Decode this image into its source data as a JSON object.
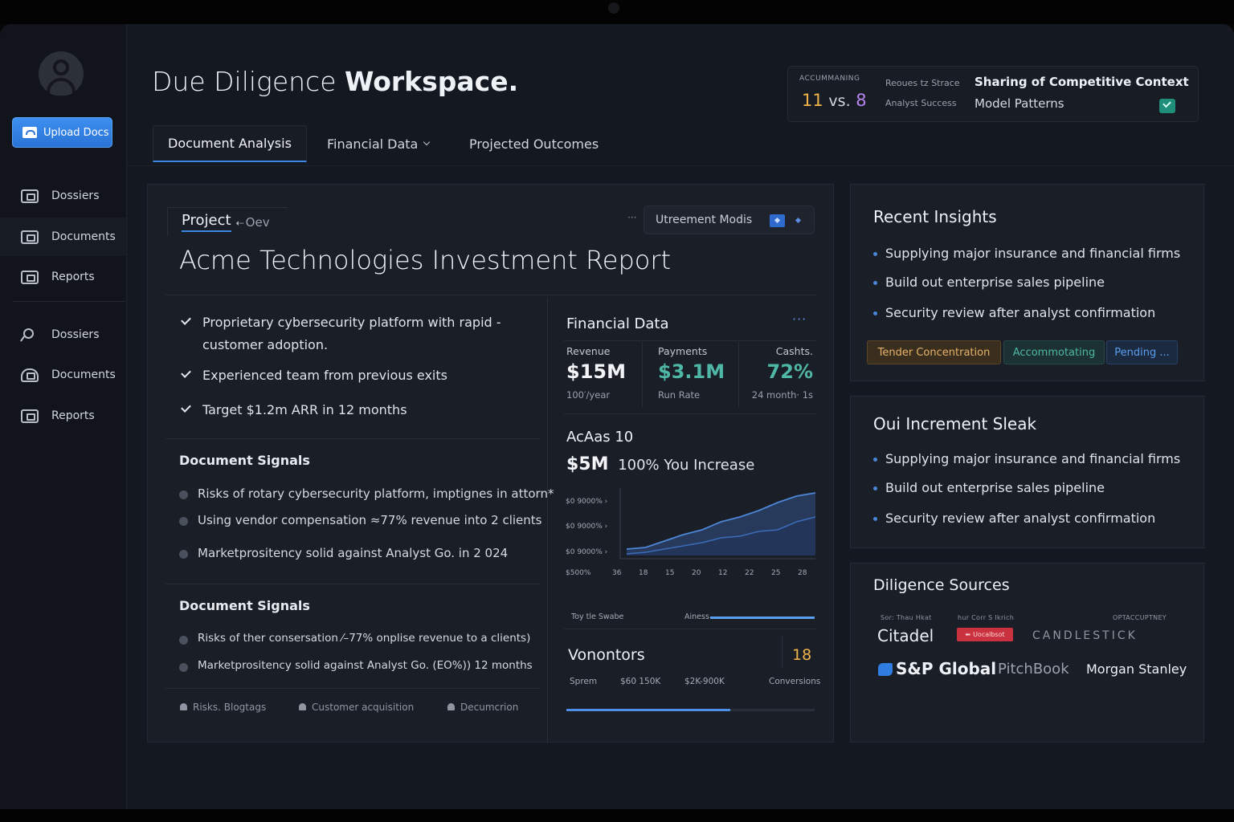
{
  "app": {
    "title_light": "Due Diligence",
    "title_bold": "Workspace."
  },
  "sidebar": {
    "upload_label": "Upload Docs",
    "items": [
      {
        "label": "Dossiers",
        "icon": "folder-icon"
      },
      {
        "label": "Documents",
        "icon": "document-icon"
      },
      {
        "label": "Reports",
        "icon": "report-icon"
      },
      {
        "label": "Dossiers",
        "icon": "link-icon"
      },
      {
        "label": "Documents",
        "icon": "cloud-icon"
      },
      {
        "label": "Reports",
        "icon": "report-icon"
      }
    ]
  },
  "stats": {
    "label_a": "ACCUMMANING",
    "value_1": "11",
    "value_vs": "vs.",
    "value_2": "8",
    "label_b1": "Reoues tz Strace",
    "label_b2": "Analyst Success",
    "headline": "Sharing of Competitive Context",
    "subline": "Model Patterns",
    "status_icon": "check-icon",
    "colors": {
      "value_1": "#f0b44a",
      "value_2": "#b586f0",
      "status": "#1f8f79"
    }
  },
  "tabs": [
    {
      "label": "Document Analysis",
      "active": true
    },
    {
      "label": "Financial Data",
      "has_dropdown": true
    },
    {
      "label": "Projected Outcomes"
    }
  ],
  "main": {
    "project_tab": "Project",
    "project_tab_extra": "Oev",
    "modis_label": "Utreement Modis",
    "title": "Acme Technologies Investment Report",
    "highlights": [
      "Proprietary cybersecurity platform with rapid - customer adoption.",
      "Experienced team from previous exits",
      "Target $1.2m ARR in 12 months"
    ],
    "signals_1": {
      "title": "Document Signals",
      "items": [
        "Risks of rotary cybersecurity platform, imptignes in attorn*",
        "Using vendor compensation ≈77% revenue into 2 clients",
        "Marketprositency solid against Analyst Go.  in 2 024"
      ]
    },
    "signals_2": {
      "title": "Document Signals",
      "items": [
        "Risks of ther consersation ⁄–77% onplise revenue to a clients)",
        "Marketprositency solid against Analyst Go.  (EO%)) 12 months"
      ]
    },
    "footer_tags": [
      "Risks. Blogtags",
      "Customer acquisition",
      "Decumcrion"
    ]
  },
  "financial": {
    "title": "Financial Data",
    "metrics": [
      {
        "label": "Revenue",
        "value": "$15M",
        "sub": "100′/year",
        "color": "#f2f4f8"
      },
      {
        "label": "Payments",
        "value": "$3.1M",
        "sub": "Run Rate",
        "color": "#4fb7a6"
      },
      {
        "label": "Cashts.",
        "value": "72%",
        "sub": "24 month· 1s",
        "color": "#4fb7a6"
      }
    ],
    "subtitle": "AcAas 10",
    "big_value": "$5M",
    "big_caption": "100% You Increase",
    "tag_left": "Toy tle Swabe",
    "tag_right": "Ainess",
    "tag_progress": 1.0,
    "vonontors_label": "Vonontors",
    "vonontors_value": "18",
    "vonontors_sub": [
      "Sprem",
      "$60 150K",
      "$2K-900K",
      "Conversions"
    ],
    "vonontors_progress": 0.66
  },
  "chart_data": {
    "type": "area",
    "y_tick_labels": [
      "$0 9000%",
      "$0 9000%",
      "$0 9000%",
      "$500%"
    ],
    "x_tick_labels": [
      "36",
      "18",
      "15",
      "20",
      "12",
      "22",
      "25",
      "28"
    ],
    "series": [
      {
        "values": [
          4,
          5,
          9,
          13,
          16,
          21,
          24,
          28,
          33,
          37,
          39
        ]
      },
      {
        "values": [
          1,
          2,
          4,
          6,
          8,
          11,
          12,
          15,
          16,
          21,
          24
        ]
      }
    ],
    "colors": {
      "fill": "#2a3f66",
      "line": "#4d86d6",
      "line2": "#3b6cb8"
    }
  },
  "insights": {
    "title": "Recent Insights",
    "items": [
      "Supplying major insurance and financial firms",
      "Build out enterprise sales pipeline",
      "Security review after analyst confirmation"
    ],
    "pills": [
      {
        "label": "Tender Concentration",
        "color": "#e7b36a"
      },
      {
        "label": "Accommotating",
        "color": "#4fb7a6"
      },
      {
        "label": "Pending ...",
        "color": "#5a9ef0"
      }
    ]
  },
  "increment": {
    "title": "Oui Increment Sleak",
    "items": [
      "Supplying major insurance and financial firms",
      "Build out enterprise sales pipeline",
      "Security review after analyst confirmation"
    ]
  },
  "sources": {
    "title": "Diligence Sources",
    "small_1": "Sor: Thau Hkat",
    "small_2": "hur Corr S Ikrich",
    "small_3": "OPTACCUPTNEY",
    "badge": "Uocalbsot",
    "logos": [
      "Citadel",
      "CANDLESTICK",
      "S&P Global",
      "PitchBook",
      "Morgan Stanley"
    ]
  }
}
